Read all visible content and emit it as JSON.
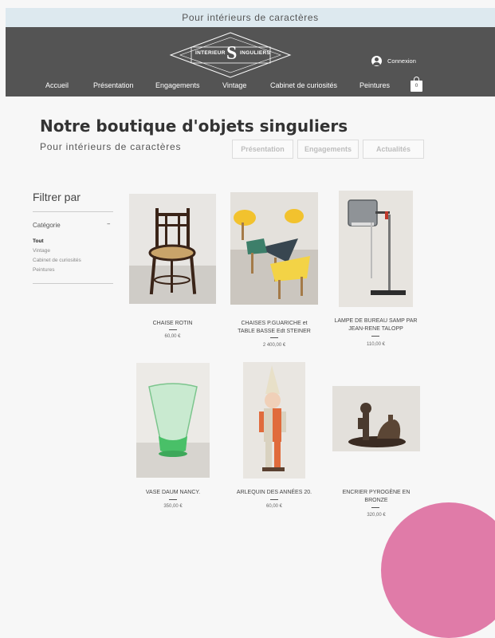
{
  "banner": {
    "text": "Pour intérieurs de caractères"
  },
  "logo": {
    "left": "INTERIEUR",
    "letter": "S",
    "right": "INGULIERS"
  },
  "header": {
    "login_label": "Connexion",
    "cart_count": "0"
  },
  "nav": {
    "items": [
      {
        "label": "Accueil"
      },
      {
        "label": "Présentation"
      },
      {
        "label": "Engagements"
      },
      {
        "label": "Vintage"
      },
      {
        "label": "Cabinet de curiosités"
      },
      {
        "label": "Peintures"
      }
    ]
  },
  "hero": {
    "title": "Notre boutique d'objets singuliers",
    "subtitle": "Pour intérieurs de caractères",
    "buttons": [
      {
        "label": "Présentation"
      },
      {
        "label": "Engagements"
      },
      {
        "label": "Actualités"
      }
    ]
  },
  "filter": {
    "title": "Filtrer par",
    "category_label": "Catégorie",
    "toggle": "–",
    "items": [
      {
        "label": "Tout"
      },
      {
        "label": "Vintage"
      },
      {
        "label": "Cabinet de curiosités"
      },
      {
        "label": "Peintures"
      }
    ]
  },
  "products": [
    {
      "name_line1": "CHAISE ROTIN",
      "name_line2": "",
      "price": "60,00 €"
    },
    {
      "name_line1": "CHAISES P.GUARICHE et",
      "name_line2": "TABLE BASSE Edt STEINER",
      "price": "2 400,00 €"
    },
    {
      "name_line1": "LAMPE DE BUREAU SAMP PAR",
      "name_line2": "JEAN-RENE TALOPP",
      "price": "110,00 €"
    },
    {
      "name_line1": "VASE DAUM NANCY.",
      "name_line2": "",
      "price": "350,00 €"
    },
    {
      "name_line1": "ARLEQUIN DES ANNÉES 20.",
      "name_line2": "",
      "price": "60,00 €"
    },
    {
      "name_line1": "ENCRIER PYROGÈNE EN",
      "name_line2": "BRONZE",
      "price": "320,00 €"
    }
  ]
}
